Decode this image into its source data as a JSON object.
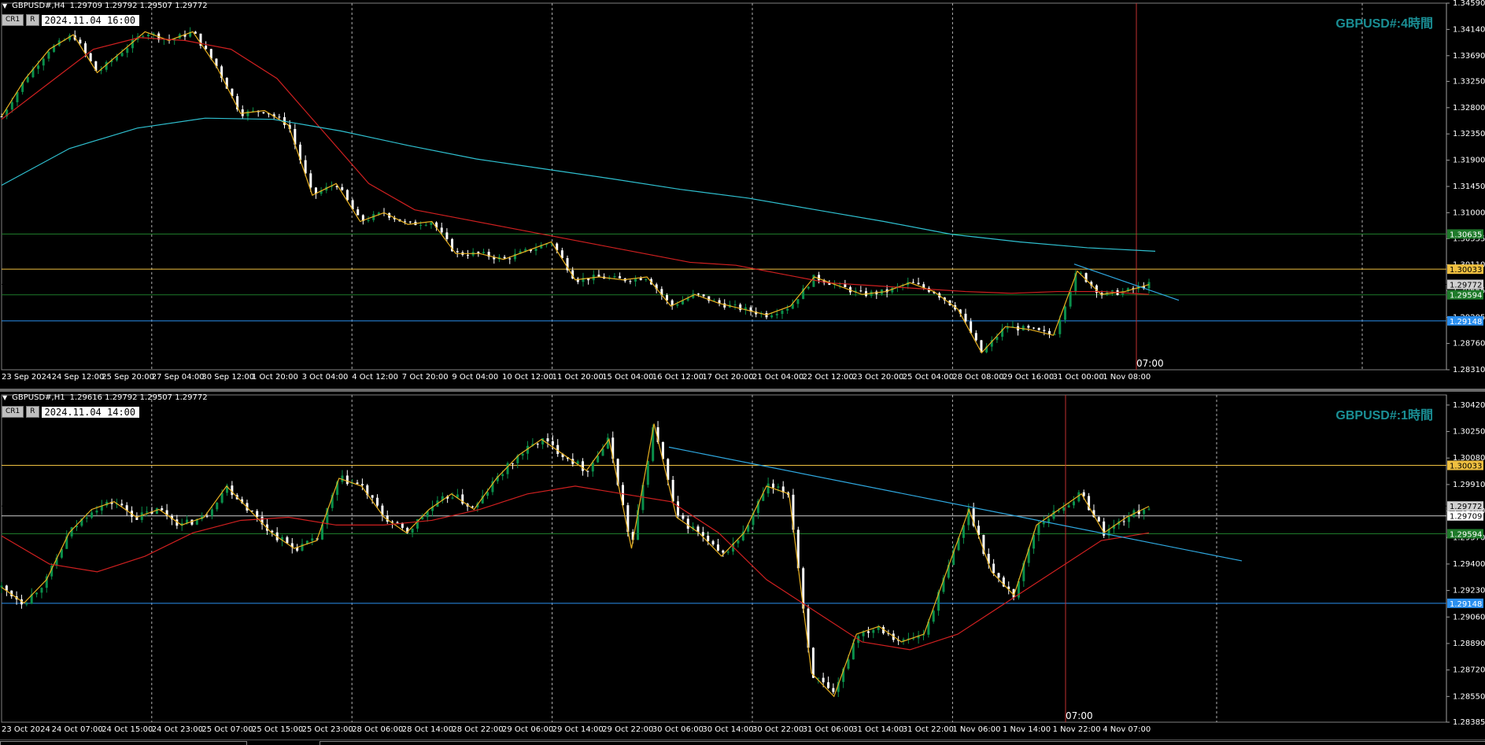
{
  "colors": {
    "candle_up": "#0a8f4b",
    "candle_down": "#ffffff",
    "ma_short": "#d02020",
    "ma_long": "#2fc0d0",
    "zigzag": "#e8b020",
    "trendline": "#2fa8e0",
    "level_orange": "#f0c040",
    "level_green": "#1e7a2a",
    "level_blue": "#2a8ff0",
    "vline": "#c03030",
    "grid": "#b0b0b0",
    "watermark": "#1a8f95"
  },
  "pane1": {
    "header": {
      "symbol": "GBPUSD#,H4",
      "ohlc": "1.29709 1.29792 1.29507 1.29772"
    },
    "buttons": [
      "CR1",
      "R"
    ],
    "datetime": "2024.11.04  16:00",
    "watermark": "GBPUSD#:4時間",
    "time_marker": "07:00",
    "hline_labels": {
      "green_top": "1.30635",
      "orange": "1.30033",
      "current": "1.29772",
      "green_mid": "1.29594",
      "blue": "1.29148"
    },
    "x_labels": [
      "23 Sep 2024",
      "24 Sep 12:00",
      "25 Sep 20:00",
      "27 Sep 04:00",
      "30 Sep 12:00",
      "1 Oct 20:00",
      "3 Oct 04:00",
      "4 Oct 12:00",
      "7 Oct 20:00",
      "9 Oct 04:00",
      "10 Oct 12:00",
      "11 Oct 20:00",
      "15 Oct 04:00",
      "16 Oct 12:00",
      "17 Oct 20:00",
      "21 Oct 04:00",
      "22 Oct 12:00",
      "23 Oct 20:00",
      "25 Oct 04:00",
      "28 Oct 08:00",
      "29 Oct 16:00",
      "31 Oct 00:00",
      "1 Nov 08:00"
    ]
  },
  "pane2": {
    "header": {
      "symbol": "GBPUSD#,H1",
      "ohlc": "1.29616 1.29792 1.29507 1.29772"
    },
    "buttons": [
      "CR1",
      "R"
    ],
    "datetime": "2024.11.04  14:00",
    "watermark": "GBPUSD#:1時間",
    "time_marker": "07:00",
    "hline_labels": {
      "orange": "1.30033",
      "current": "1.29772",
      "white": "1.29709",
      "green_mid": "1.29594",
      "blue": "1.29148"
    },
    "x_labels": [
      "23 Oct 2024",
      "24 Oct 07:00",
      "24 Oct 15:00",
      "24 Oct 23:00",
      "25 Oct 07:00",
      "25 Oct 15:00",
      "25 Oct 23:00",
      "28 Oct 06:00",
      "28 Oct 14:00",
      "28 Oct 22:00",
      "29 Oct 06:00",
      "29 Oct 14:00",
      "29 Oct 22:00",
      "30 Oct 06:00",
      "30 Oct 14:00",
      "30 Oct 22:00",
      "31 Oct 06:00",
      "31 Oct 14:00",
      "31 Oct 22:00",
      "1 Nov 06:00",
      "1 Nov 14:00",
      "1 Nov 22:00",
      "4 Nov 07:00"
    ]
  },
  "chart_data": [
    {
      "type": "candlestick",
      "title": "GBPUSD#:4時間",
      "timeframe": "H4",
      "ylim": [
        1.2831,
        1.3459
      ],
      "y_ticks": [
        1.3459,
        1.3414,
        1.3369,
        1.3325,
        1.328,
        1.3235,
        1.319,
        1.3145,
        1.31,
        1.30555,
        1.3011,
        1.29665,
        1.29205,
        1.2876,
        1.2831
      ],
      "x": [
        "23 Sep 2024",
        "24 Sep 12:00",
        "25 Sep 20:00",
        "27 Sep 04:00",
        "30 Sep 12:00",
        "1 Oct 20:00",
        "3 Oct 04:00",
        "4 Oct 12:00",
        "7 Oct 20:00",
        "9 Oct 04:00",
        "10 Oct 12:00",
        "11 Oct 20:00",
        "15 Oct 04:00",
        "16 Oct 12:00",
        "17 Oct 20:00",
        "21 Oct 04:00",
        "22 Oct 12:00",
        "23 Oct 20:00",
        "25 Oct 04:00",
        "28 Oct 08:00",
        "29 Oct 16:00",
        "31 Oct 00:00",
        "1 Nov 08:00"
      ],
      "close_path": [
        1.3265,
        1.333,
        1.338,
        1.3405,
        1.334,
        1.3375,
        1.341,
        1.3395,
        1.341,
        1.335,
        1.327,
        1.3275,
        1.325,
        1.313,
        1.315,
        1.3085,
        1.31,
        1.308,
        1.3085,
        1.303,
        1.303,
        1.302,
        1.3035,
        1.305,
        1.2985,
        1.299,
        1.2985,
        1.299,
        1.294,
        1.296,
        1.2945,
        1.2935,
        1.2925,
        1.294,
        1.299,
        1.2975,
        1.296,
        1.2965,
        1.298,
        1.2965,
        1.2935,
        1.286,
        1.2905,
        1.29,
        1.289,
        1.3,
        1.296,
        1.2965,
        1.2977
      ],
      "series": [
        {
          "name": "MA short",
          "values": [
            1.326,
            1.332,
            1.338,
            1.34,
            1.3395,
            1.338,
            1.333,
            1.324,
            1.315,
            1.3105,
            1.309,
            1.3075,
            1.306,
            1.3045,
            1.303,
            1.3015,
            1.301,
            1.2995,
            1.298,
            1.2975,
            1.297,
            1.2965,
            1.2962,
            1.2965,
            1.2965,
            1.296
          ]
        },
        {
          "name": "MA long",
          "values": [
            1.3147,
            1.321,
            1.3245,
            1.3262,
            1.326,
            1.324,
            1.3215,
            1.3192,
            1.3175,
            1.3158,
            1.314,
            1.3125,
            1.3105,
            1.3085,
            1.3063,
            1.305,
            1.304,
            1.3034
          ]
        }
      ],
      "levels": [
        1.30635,
        1.30033,
        1.29772,
        1.29594,
        1.29148
      ]
    },
    {
      "type": "candlestick",
      "title": "GBPUSD#:1時間",
      "timeframe": "H1",
      "ylim": [
        1.28385,
        1.30485
      ],
      "y_ticks": [
        1.3042,
        1.3025,
        1.3008,
        1.2991,
        1.2974,
        1.2957,
        1.294,
        1.2923,
        1.2906,
        1.2889,
        1.2872,
        1.2855,
        1.28385
      ],
      "x": [
        "23 Oct 2024",
        "24 Oct 07:00",
        "24 Oct 15:00",
        "24 Oct 23:00",
        "25 Oct 07:00",
        "25 Oct 15:00",
        "25 Oct 23:00",
        "28 Oct 06:00",
        "28 Oct 14:00",
        "28 Oct 22:00",
        "29 Oct 06:00",
        "29 Oct 14:00",
        "29 Oct 22:00",
        "30 Oct 06:00",
        "30 Oct 14:00",
        "30 Oct 22:00",
        "31 Oct 06:00",
        "31 Oct 14:00",
        "31 Oct 22:00",
        "1 Nov 06:00",
        "1 Nov 14:00",
        "1 Nov 22:00",
        "4 Nov 07:00"
      ],
      "close_path": [
        1.2925,
        1.2915,
        1.293,
        1.296,
        1.2975,
        1.298,
        1.297,
        1.2975,
        1.2965,
        1.297,
        1.299,
        1.2975,
        1.296,
        1.295,
        1.2955,
        1.2995,
        1.299,
        1.297,
        1.296,
        1.2975,
        1.2985,
        1.2975,
        1.2995,
        1.301,
        1.302,
        1.301,
        1.3,
        1.302,
        1.295,
        1.303,
        1.297,
        1.296,
        1.2945,
        1.296,
        1.299,
        1.2985,
        1.287,
        1.2855,
        1.2895,
        1.29,
        1.289,
        1.2895,
        1.2935,
        1.2975,
        1.2935,
        1.292,
        1.2965,
        1.2975,
        1.2985,
        1.296,
        1.297,
        1.2977
      ],
      "series": [
        {
          "name": "MA short",
          "values": [
            1.2958,
            1.294,
            1.2935,
            1.2945,
            1.296,
            1.2968,
            1.297,
            1.2965,
            1.2965,
            1.2968,
            1.2975,
            1.2985,
            1.299,
            1.2985,
            1.298,
            1.296,
            1.293,
            1.291,
            1.289,
            1.2885,
            1.2895,
            1.2915,
            1.2935,
            1.2955,
            1.296
          ]
        }
      ],
      "levels": [
        1.30033,
        1.29772,
        1.29709,
        1.29594,
        1.29148
      ]
    }
  ]
}
